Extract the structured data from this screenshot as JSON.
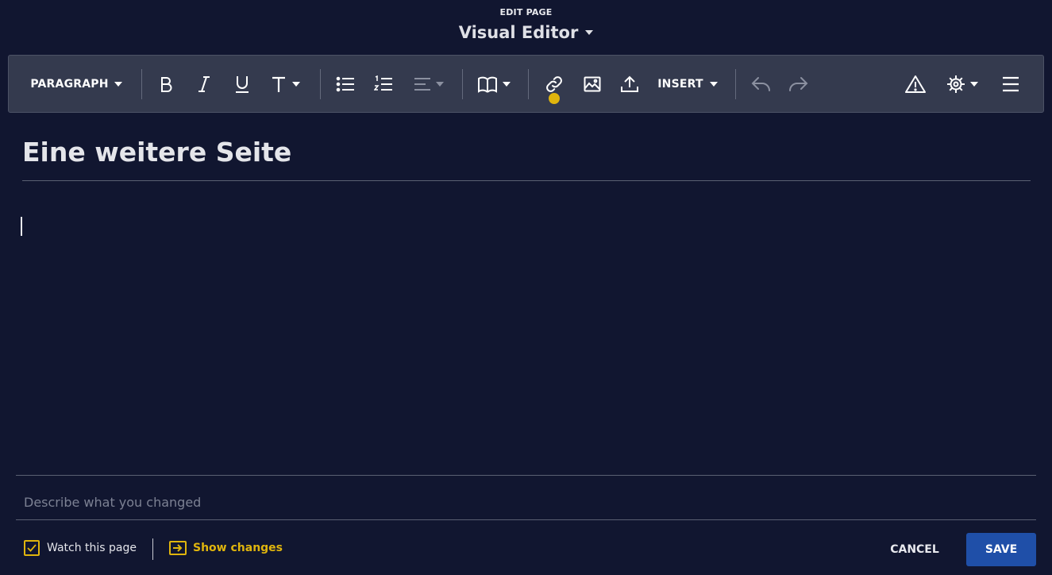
{
  "header": {
    "kicker": "EDIT PAGE",
    "mode": "Visual Editor"
  },
  "toolbar": {
    "format_label": "PARAGRAPH",
    "insert_label": "INSERT",
    "icons": [
      "bold-icon",
      "italic-icon",
      "underline-icon",
      "text-style-icon",
      "bulleted-list-icon",
      "numbered-list-icon",
      "align-icon",
      "cite-icon",
      "link-icon",
      "image-icon",
      "upload-icon",
      "undo-icon",
      "redo-icon",
      "warning-icon",
      "gear-icon",
      "menu-icon"
    ]
  },
  "editor": {
    "page_title": "Eine weitere Seite",
    "body_text": ""
  },
  "summary": {
    "placeholder": "Describe what you changed",
    "value": ""
  },
  "footer": {
    "watch_label": "Watch this page",
    "watch_checked": true,
    "show_changes_label": "Show changes",
    "cancel_label": "CANCEL",
    "save_label": "SAVE"
  },
  "colors": {
    "background": "#111630",
    "toolbar": "#343a4e",
    "accent": "#e0b50d",
    "primary_button": "#1f4fa8"
  }
}
